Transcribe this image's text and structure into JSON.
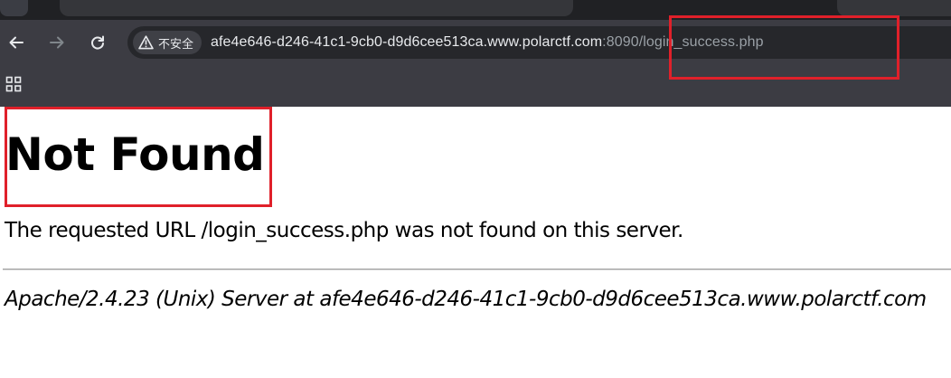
{
  "browser": {
    "security_label": "不安全",
    "url_host": "afe4e646-d246-41c1-9cb0-d9d6cee513ca.www.polarctf.com",
    "url_path": ":8090/login_success.php",
    "icons": [
      "back-arrow-icon",
      "forward-arrow-icon",
      "reload-icon",
      "warning-icon",
      "apps-grid-icon"
    ]
  },
  "page": {
    "title": "Not Found",
    "message": "The requested URL /login_success.php was not found on this server.",
    "server_signature": "Apache/2.4.23 (Unix) Server at afe4e646-d246-41c1-9cb0-d9d6cee513ca.www.polarctf.com"
  },
  "annotation_color": "#e0202a"
}
